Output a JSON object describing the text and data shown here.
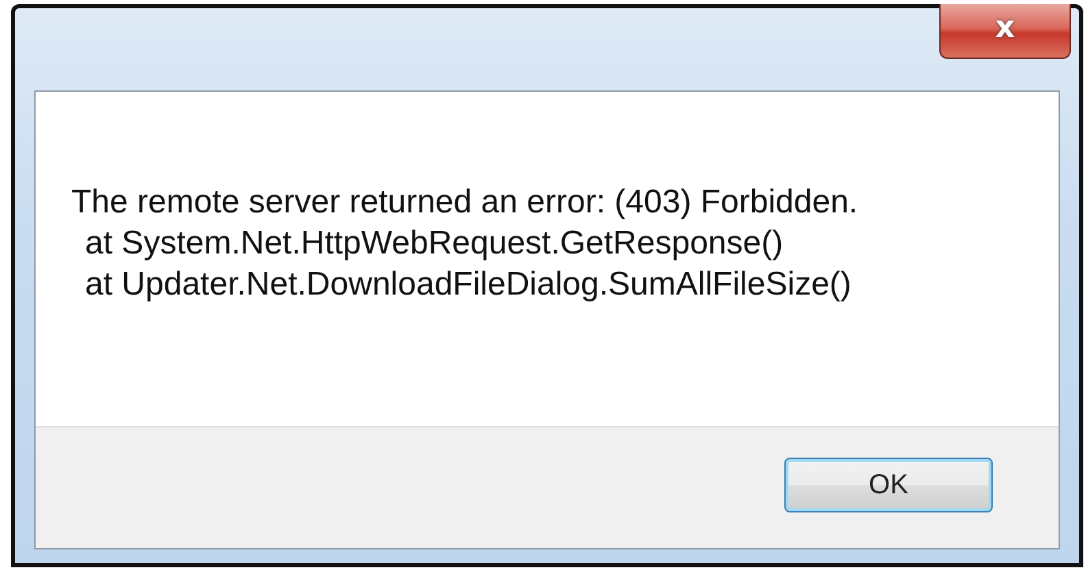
{
  "window": {
    "close_button": "x"
  },
  "message": {
    "lines": [
      {
        "text": "The remote server returned an error: (403) Forbidden.",
        "indented": false
      },
      {
        "text": "at System.Net.HttpWebRequest.GetResponse()",
        "indented": true
      },
      {
        "text": "at Updater.Net.DownloadFileDialog.SumAllFileSize()",
        "indented": true
      }
    ]
  },
  "buttons": [
    {
      "label": "OK",
      "default": true
    }
  ]
}
